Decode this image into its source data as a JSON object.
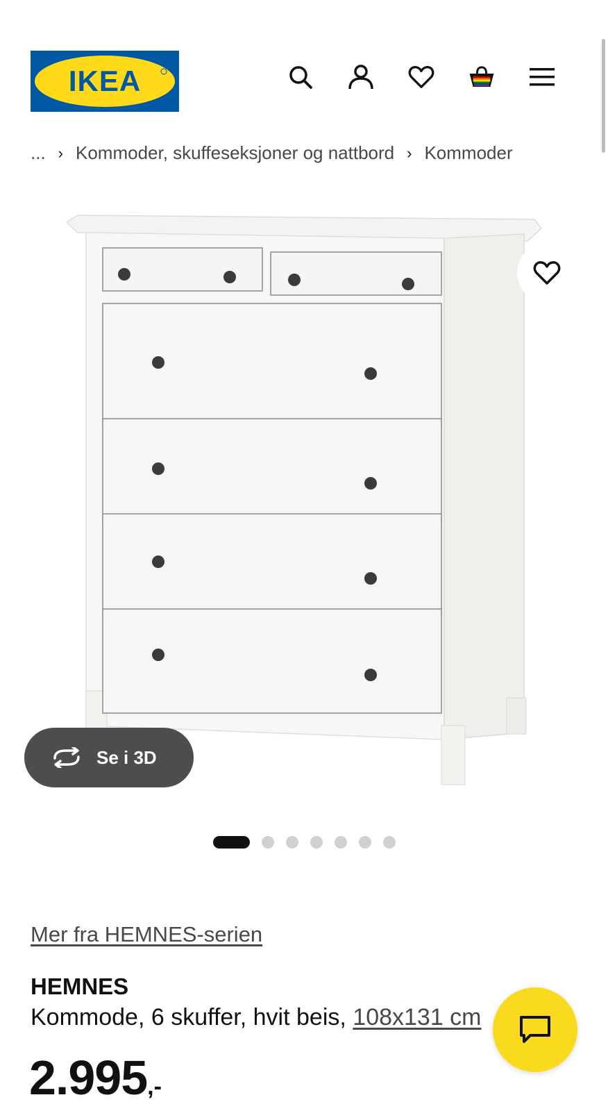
{
  "brand": {
    "logo_text": "IKEA",
    "colors": {
      "blue": "#0058a3",
      "yellow": "#ffda1a"
    }
  },
  "header": {
    "icons": [
      "search-icon",
      "account-icon",
      "heart-icon",
      "basket-icon",
      "menu-icon"
    ]
  },
  "breadcrumb": {
    "ellipsis": "...",
    "items": [
      "Kommoder, skuffeseksjoner og nattbord",
      "Kommoder"
    ]
  },
  "gallery": {
    "view_3d_label": "Se i 3D",
    "slide_count": 7,
    "active_slide": 1
  },
  "product": {
    "series_link": "Mer fra HEMNES-serien",
    "name": "HEMNES",
    "description": "Kommode, 6 skuffer, hvit beis,",
    "dimensions": "108x131 cm",
    "price_integer": "2.995",
    "price_decimal": ",-"
  }
}
